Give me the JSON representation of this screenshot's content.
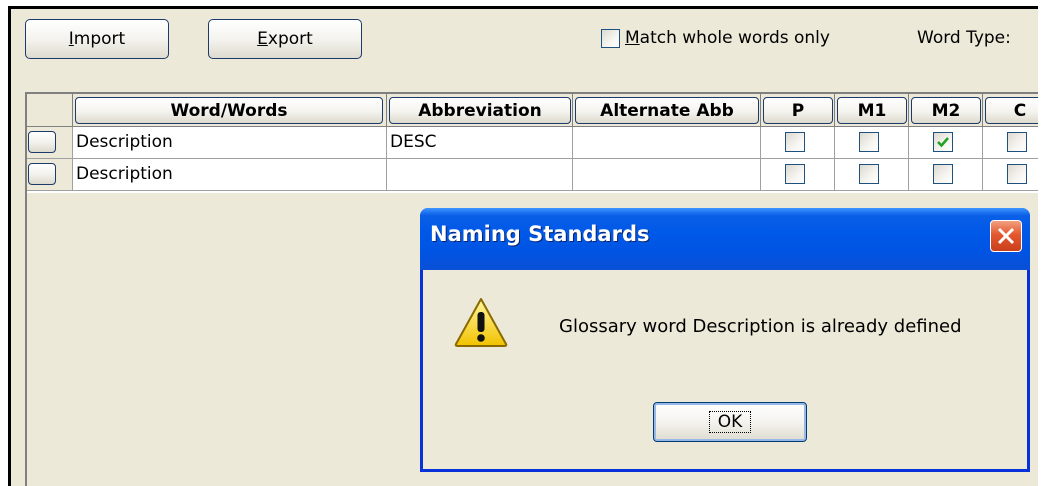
{
  "toolbar": {
    "import_label": "Import",
    "export_label": "Export",
    "match_whole_words_label": "Match whole words only",
    "match_whole_words_checked": false,
    "word_type_label": "Word Type:"
  },
  "grid": {
    "columns": [
      "Word/Words",
      "Abbreviation",
      "Alternate Abb",
      "P",
      "M1",
      "M2",
      "C"
    ],
    "rows": [
      {
        "word": "Description",
        "abbreviation": "DESC",
        "alternate": "",
        "P": false,
        "M1": false,
        "M2": true,
        "C": false
      },
      {
        "word": "Description",
        "abbreviation": "",
        "alternate": "",
        "P": false,
        "M1": false,
        "M2": false,
        "C": false
      }
    ]
  },
  "dialog": {
    "title": "Naming Standards",
    "message": "Glossary word Description is already defined",
    "ok_label": "OK",
    "icon": "warning-icon"
  },
  "colors": {
    "titlebar": "#0054e3",
    "window_bg": "#ece9d8",
    "check_green": "#21a121",
    "close_red": "#e4582f"
  }
}
